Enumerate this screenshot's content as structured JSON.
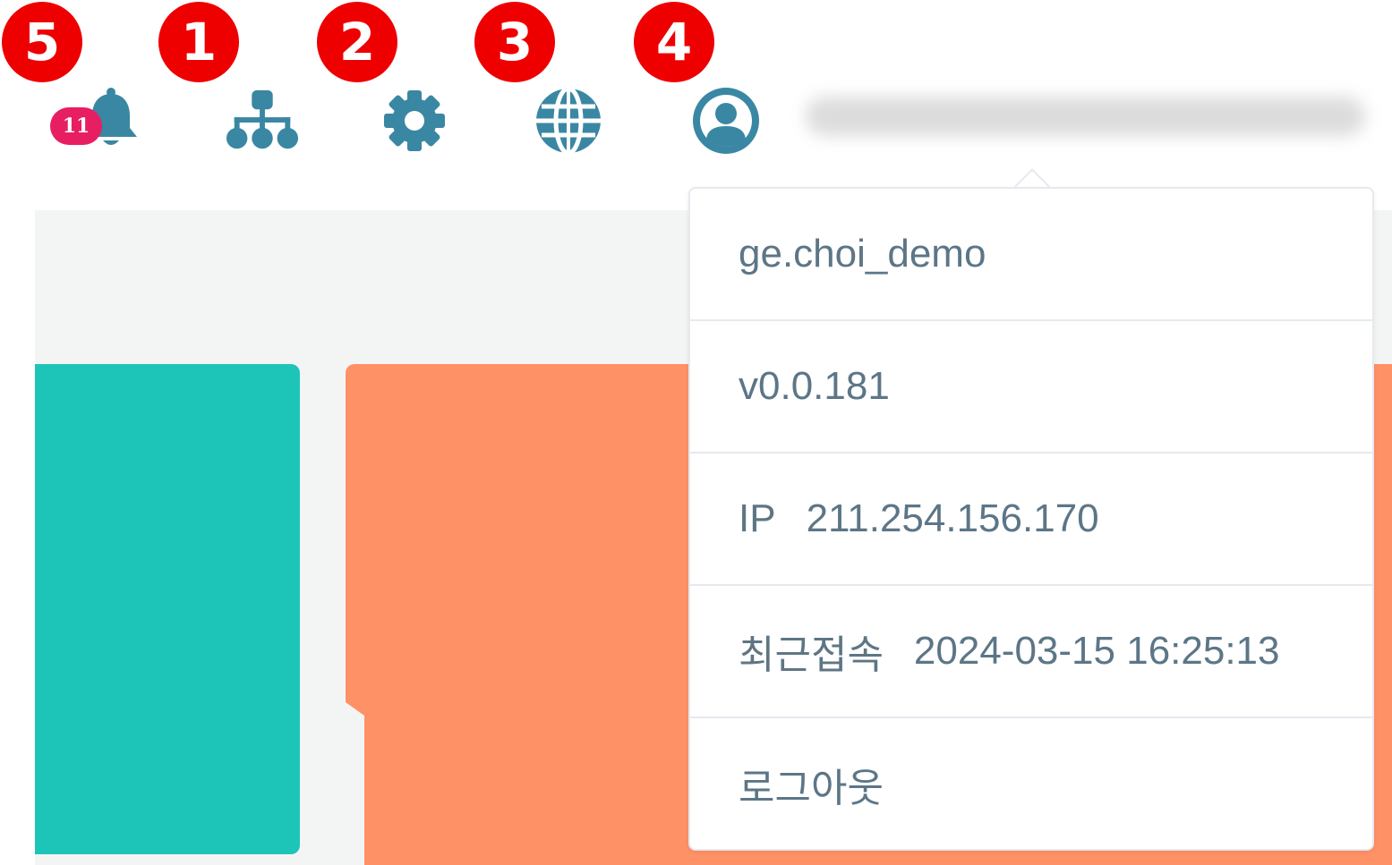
{
  "markers": [
    "5",
    "1",
    "2",
    "3",
    "4"
  ],
  "header": {
    "notification_count": "11",
    "icons": [
      "bell-icon",
      "sitemap-icon",
      "gear-icon",
      "globe-icon",
      "user-circle-icon"
    ],
    "icon_color": "#3a87a3"
  },
  "user_menu": {
    "username": "ge.choi_demo",
    "version": "v0.0.181",
    "ip_label": "IP",
    "ip_value": "211.254.156.170",
    "last_login_label": "최근접속",
    "last_login_value": "2024-03-15 16:25:13",
    "logout_label": "로그아웃"
  },
  "colors": {
    "marker": "#ee0000",
    "badge": "#e81e63",
    "card_teal": "#1dc5b8",
    "card_orange": "#ff9166"
  }
}
